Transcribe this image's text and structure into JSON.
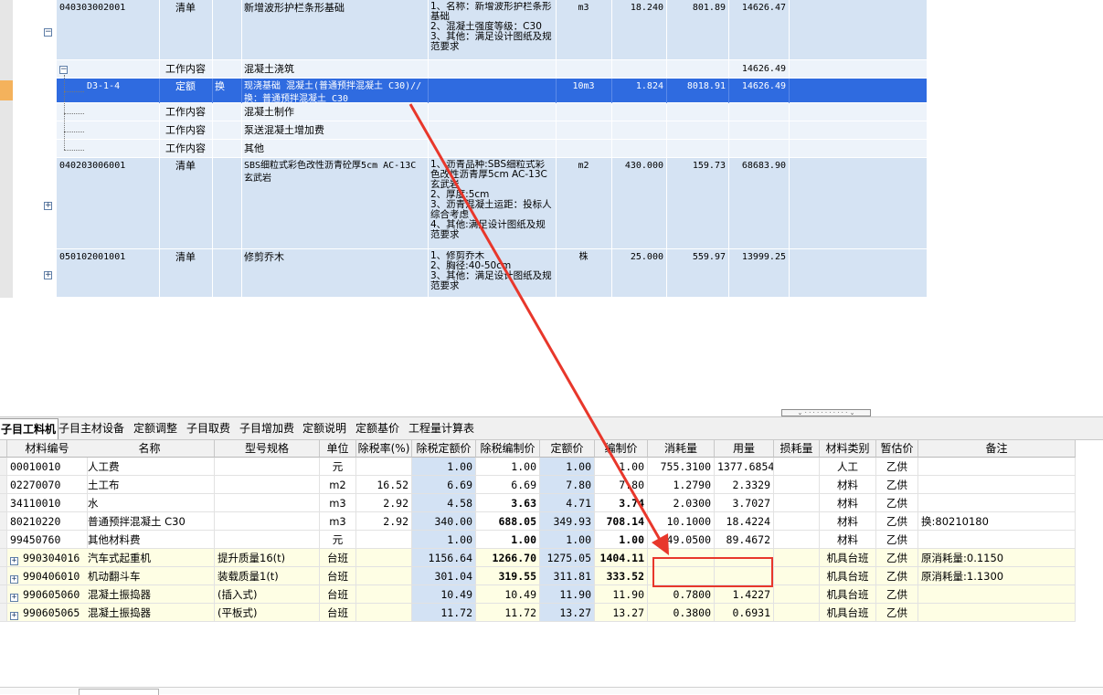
{
  "top_rows": [
    {
      "code": "040303002001",
      "type": "清单",
      "mark": "",
      "name": "新增波形护栏条形基础",
      "feature": "1、名称：新增波形护栏条形基础\n2、混凝土强度等级：C30\n3、其他：满足设计图纸及规范要求",
      "unit": "m3",
      "qty": "18.240",
      "price": "801.89",
      "total": "14626.47"
    },
    {
      "code": "",
      "type": "工作内容",
      "mark": "",
      "name": "混凝土浇筑",
      "feature": "",
      "unit": "",
      "qty": "",
      "price": "",
      "total": "14626.49"
    },
    {
      "code": "D3-1-4",
      "type": "定额",
      "mark": "换",
      "name": "现浇基础 混凝土(普通预拌混凝土 C30)//换：普通预拌混凝土 C30",
      "feature": "",
      "unit": "10m3",
      "qty": "1.824",
      "price": "8018.91",
      "total": "14626.49"
    },
    {
      "code": "",
      "type": "工作内容",
      "mark": "",
      "name": "混凝土制作",
      "feature": "",
      "unit": "",
      "qty": "",
      "price": "",
      "total": ""
    },
    {
      "code": "",
      "type": "工作内容",
      "mark": "",
      "name": "泵送混凝土增加费",
      "feature": "",
      "unit": "",
      "qty": "",
      "price": "",
      "total": ""
    },
    {
      "code": "",
      "type": "工作内容",
      "mark": "",
      "name": "其他",
      "feature": "",
      "unit": "",
      "qty": "",
      "price": "",
      "total": ""
    },
    {
      "code": "040203006001",
      "type": "清单",
      "mark": "",
      "name": "SBS细粒式彩色改性沥青砼厚5cm AC-13C 玄武岩",
      "feature": "1、沥青品种:SBS细粒式彩色改性沥青厚5cm AC-13C 玄武岩\n2、厚度:5cm\n3、沥青混凝土运距：投标人综合考虑\n4、其他:满足设计图纸及规范要求",
      "unit": "m2",
      "qty": "430.000",
      "price": "159.73",
      "total": "68683.90"
    },
    {
      "code": "050102001001",
      "type": "清单",
      "mark": "",
      "name": "修剪乔木",
      "feature": "1、修剪乔木\n2、胸径:40-50cm\n3、其他：满足设计图纸及规范要求",
      "unit": "株",
      "qty": "25.000",
      "price": "559.97",
      "total": "13999.25"
    }
  ],
  "tabs": [
    "子目工料机",
    "子目主材设备",
    "定额调整",
    "子目取费",
    "子目增加费",
    "定额说明",
    "定额基价",
    "工程量计算表"
  ],
  "bottom_headers": [
    "材料编号",
    "名称",
    "型号规格",
    "单位",
    "除税率(%)",
    "除税定额价",
    "除税编制价",
    "定额价",
    "编制价",
    "消耗量",
    "用量",
    "损耗量",
    "材料类别",
    "暂估价",
    "备注"
  ],
  "bottom_rows": [
    {
      "expand": false,
      "code": "00010010",
      "name": "人工费",
      "spec": "",
      "unit": "元",
      "rate": "",
      "base": "1.00",
      "tax_price": "1.00",
      "quota": "1.00",
      "price": "1.00",
      "consume": "755.3100",
      "usage": "1377.6854",
      "loss": "",
      "cat": "人工",
      "est": "乙供",
      "note": ""
    },
    {
      "expand": false,
      "code": "02270070",
      "name": "土工布",
      "spec": "",
      "unit": "m2",
      "rate": "16.52",
      "base": "6.69",
      "tax_price": "6.69",
      "quota": "7.80",
      "price": "7.80",
      "consume": "1.2790",
      "usage": "2.3329",
      "loss": "",
      "cat": "材料",
      "est": "乙供",
      "note": ""
    },
    {
      "expand": false,
      "code": "34110010",
      "name": "水",
      "spec": "",
      "unit": "m3",
      "rate": "2.92",
      "base": "4.58",
      "tax_price": "3.63",
      "quota": "4.71",
      "price": "3.74",
      "consume": "2.0300",
      "usage": "3.7027",
      "loss": "",
      "cat": "材料",
      "est": "乙供",
      "note": ""
    },
    {
      "expand": false,
      "code": "80210220",
      "name": "普通预拌混凝土 C30",
      "spec": "",
      "unit": "m3",
      "rate": "2.92",
      "base": "340.00",
      "tax_price": "688.05",
      "quota": "349.93",
      "price": "708.14",
      "consume": "10.1000",
      "usage": "18.4224",
      "loss": "",
      "cat": "材料",
      "est": "乙供",
      "note": "换:80210180"
    },
    {
      "expand": false,
      "code": "99450760",
      "name": "其他材料费",
      "spec": "",
      "unit": "元",
      "rate": "",
      "base": "1.00",
      "tax_price": "1.00",
      "quota": "1.00",
      "price": "1.00",
      "consume": "49.0500",
      "usage": "89.4672",
      "loss": "",
      "cat": "材料",
      "est": "乙供",
      "note": ""
    },
    {
      "expand": true,
      "code": "990304016",
      "name": "汽车式起重机",
      "spec": "提升质量16(t)",
      "unit": "台班",
      "rate": "",
      "base": "1156.64",
      "tax_price": "1266.70",
      "quota": "1275.05",
      "price": "1404.11",
      "consume": "",
      "usage": "",
      "loss": "",
      "cat": "机具台班",
      "est": "乙供",
      "note": "原消耗量:0.1150"
    },
    {
      "expand": true,
      "code": "990406010",
      "name": "机动翻斗车",
      "spec": "装载质量1(t)",
      "unit": "台班",
      "rate": "",
      "base": "301.04",
      "tax_price": "319.55",
      "quota": "311.81",
      "price": "333.52",
      "consume": "",
      "usage": "",
      "loss": "",
      "cat": "机具台班",
      "est": "乙供",
      "note": "原消耗量:1.1300"
    },
    {
      "expand": true,
      "code": "990605060",
      "name": "混凝土振捣器",
      "spec": "(插入式)",
      "unit": "台班",
      "rate": "",
      "base": "10.49",
      "tax_price": "10.49",
      "quota": "11.90",
      "price": "11.90",
      "consume": "0.7800",
      "usage": "1.4227",
      "loss": "",
      "cat": "机具台班",
      "est": "乙供",
      "note": ""
    },
    {
      "expand": true,
      "code": "990605065",
      "name": "混凝土振捣器",
      "spec": "(平板式)",
      "unit": "台班",
      "rate": "",
      "base": "11.72",
      "tax_price": "11.72",
      "quota": "13.27",
      "price": "13.27",
      "consume": "0.3800",
      "usage": "0.6931",
      "loss": "",
      "cat": "机具台班",
      "est": "乙供",
      "note": ""
    }
  ],
  "colors": {
    "bill_row": "#d5e3f3",
    "work_row": "#edf3fa",
    "selected_row": "#2f6be0",
    "arrow": "#e8372b",
    "highlight_box": "#e8372b",
    "machine_row": "#fefee4",
    "price_col": "#d3e2f4"
  }
}
